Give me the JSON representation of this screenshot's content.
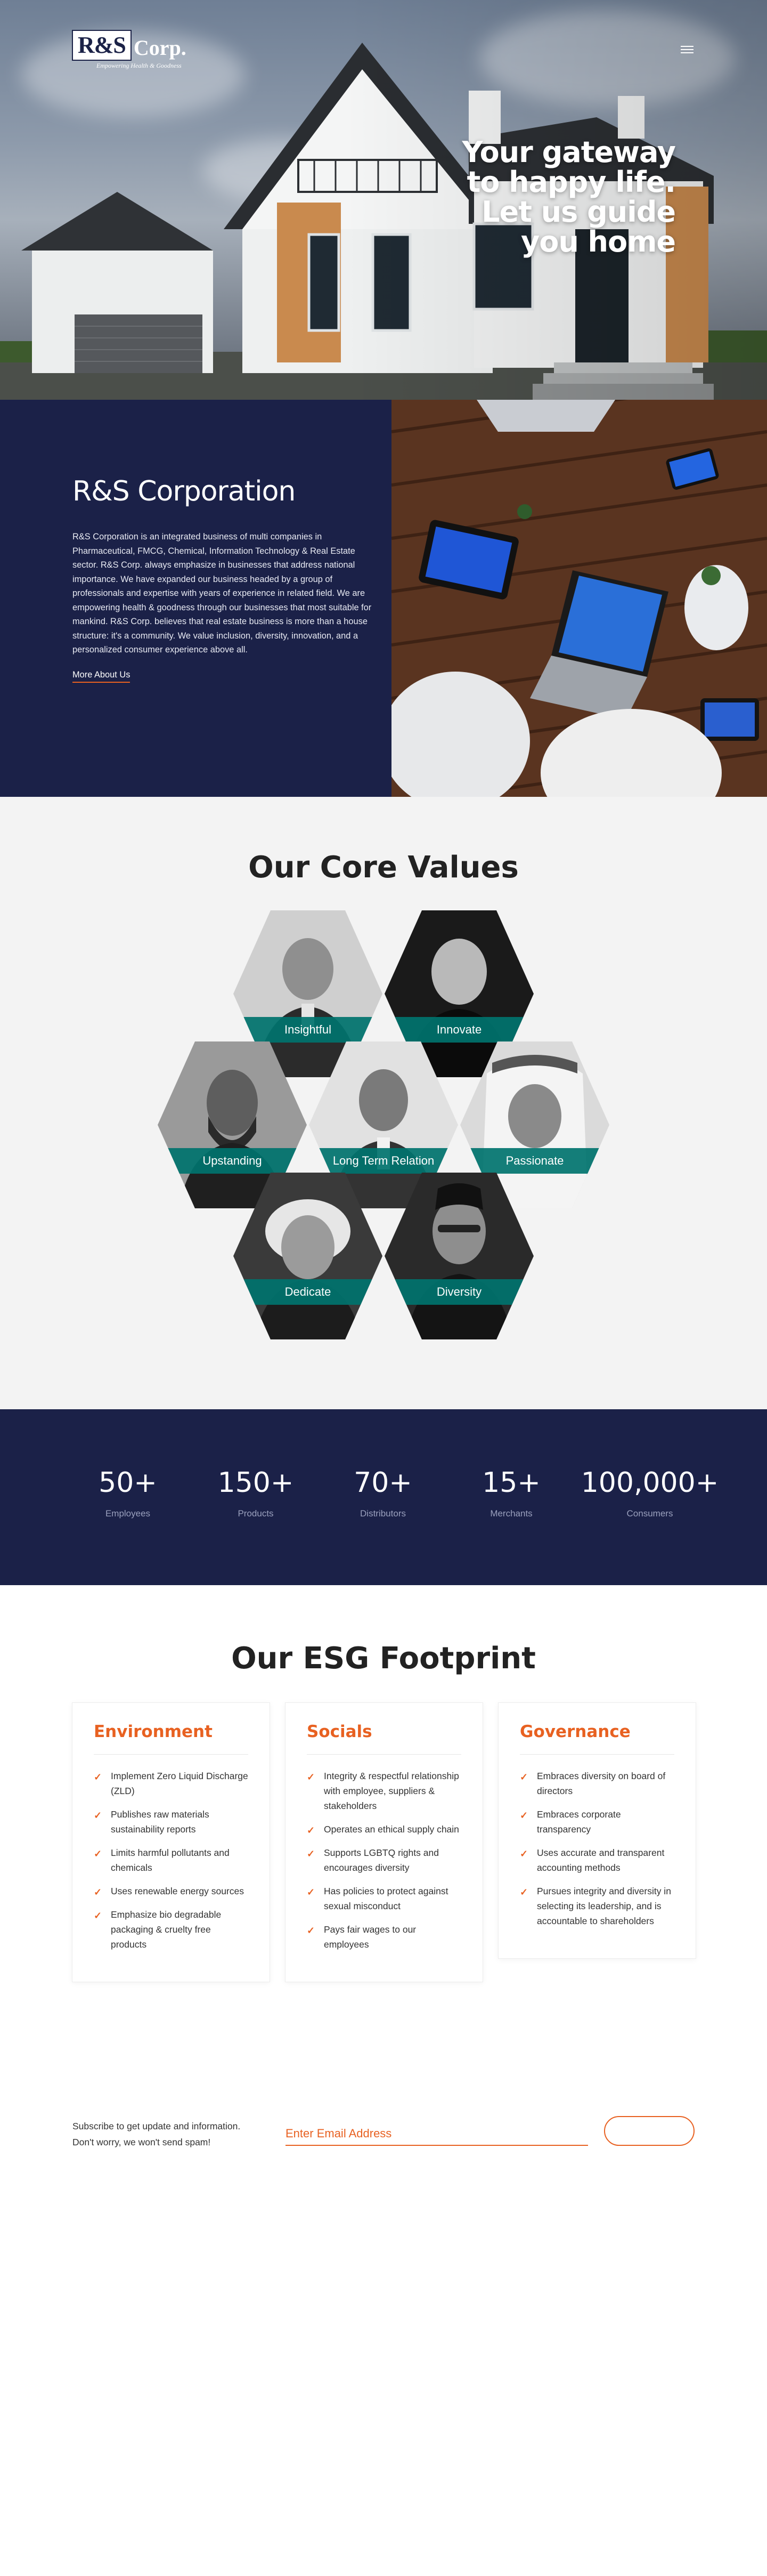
{
  "header": {
    "logo_mark": "R&S",
    "logo_word": "Corp.",
    "logo_tagline": "Empowering Health & Goodness",
    "menu_icon": "hamburger-menu-icon"
  },
  "hero": {
    "headline": [
      "Your gateway",
      "to happy life.",
      "Let us guide",
      "you home"
    ]
  },
  "about": {
    "title": "R&S Corporation",
    "body": "R&S Corporation is an integrated business of multi companies in Pharmaceutical, FMCG, Chemical, Information Technology & Real Estate sector. R&S Corp. always emphasize in businesses that address national importance. We have expanded our business headed by a group of professionals and expertise with years of experience in related field. We are empowering health & goodness through our businesses that most suitable for mankind. R&S Corp. believes that real estate business is more than a house structure: it's a community. We value inclusion, diversity, innovation, and a personalized consumer experience above all.",
    "link_label": "More About Us"
  },
  "core_values": {
    "title": "Our Core Values",
    "items": [
      "Insightful",
      "Innovate",
      "Upstanding",
      "Long Term Relation",
      "Passionate",
      "Dedicate",
      "Diversity"
    ]
  },
  "stats": [
    {
      "value": "50+",
      "label": "Employees"
    },
    {
      "value": "150+",
      "label": "Products"
    },
    {
      "value": "70+",
      "label": "Distributors"
    },
    {
      "value": "15+",
      "label": "Merchants"
    },
    {
      "value": "100,000+",
      "label": "Consumers"
    }
  ],
  "esg": {
    "title": "Our ESG Footprint",
    "cards": [
      {
        "title": "Environment",
        "items": [
          "Implement Zero Liquid Discharge (ZLD)",
          "Publishes raw materials sustainability reports",
          "Limits harmful pollutants and chemicals",
          "Uses renewable energy sources",
          "Emphasize bio degradable packaging & cruelty free products"
        ]
      },
      {
        "title": "Socials",
        "items": [
          "Integrity & respectful relationship with employee, suppliers & stakeholders",
          "Operates an ethical supply chain",
          "Supports LGBTQ rights and encourages diversity",
          "Has policies to protect against sexual misconduct",
          "Pays fair wages to our employees"
        ]
      },
      {
        "title": "Governance",
        "items": [
          "Embraces diversity on board of directors",
          "Embraces corporate transparency",
          "Uses accurate and transparent accounting methods",
          "Pursues integrity and diversity in selecting its leadership, and is accountable to shareholders"
        ]
      }
    ]
  },
  "newsletter": {
    "line1": "Subscribe to get update and information.",
    "line2": "Don't worry, we won't send spam!",
    "placeholder": "Enter Email Address",
    "button_label": ""
  },
  "colors": {
    "navy": "#1b2148",
    "accent": "#e86121",
    "teal": "#00736e"
  }
}
